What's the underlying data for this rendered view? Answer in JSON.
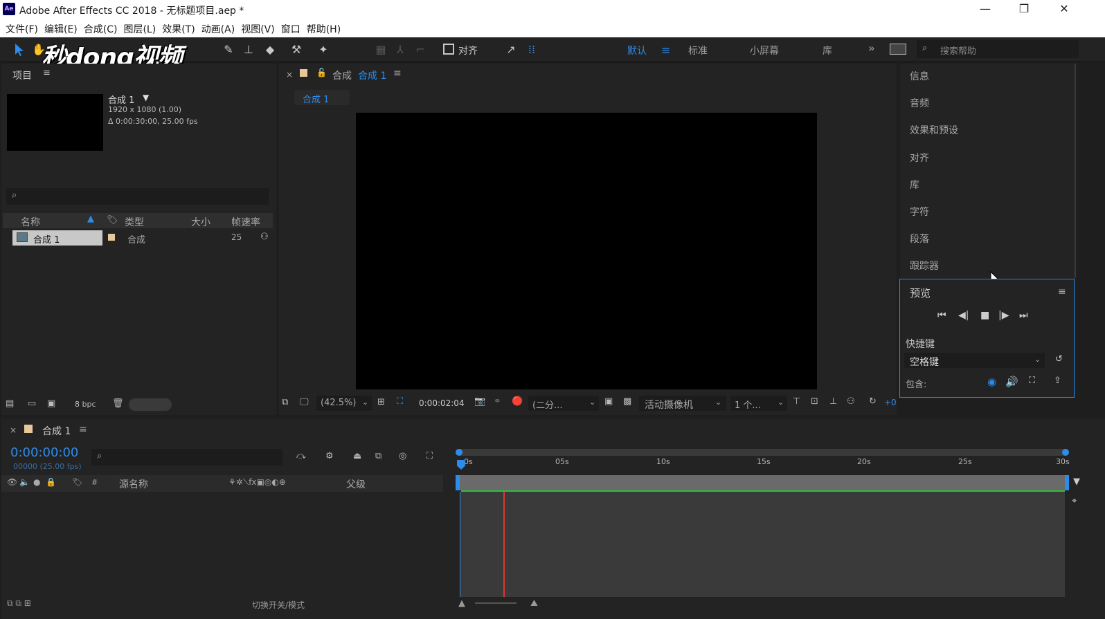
{
  "window": {
    "app_icon": "Ae",
    "title": "Adobe After Effects CC 2018 - 无标题项目.aep *",
    "minimize": "—",
    "maximize": "❐",
    "close": "✕"
  },
  "menu": [
    "文件(F)",
    "编辑(E)",
    "合成(C)",
    "图层(L)",
    "效果(T)",
    "动画(A)",
    "视图(V)",
    "窗口",
    "帮助(H)"
  ],
  "watermark": "秒dong视频",
  "toolbar": {
    "align_label": "对齐",
    "workspaces": [
      "默认",
      "标准",
      "小屏幕",
      "库"
    ],
    "more": "»",
    "search_placeholder": "搜索帮助"
  },
  "project": {
    "title": "项目",
    "comp_name": "合成 1",
    "comp_res": "1920 x 1080 (1.00)",
    "comp_dur": "Δ 0:00:30:00, 25.00 fps",
    "columns": [
      "名称",
      "类型",
      "大小",
      "帧速率"
    ],
    "rows": [
      {
        "name": "合成 1",
        "type": "合成",
        "size": "",
        "fps": "25"
      }
    ],
    "bpc": "8 bpc"
  },
  "composition": {
    "panel_prefix": "合成",
    "panel_name": "合成 1",
    "tab": "合成 1",
    "zoom": "(42.5%)",
    "timecode": "0:00:02:04",
    "resolution": "(二分...",
    "camera": "活动摄像机",
    "views": "1 个...",
    "exposure": "+0"
  },
  "right_panels": [
    "信息",
    "音频",
    "效果和预设",
    "对齐",
    "库",
    "字符",
    "段落",
    "跟踪器"
  ],
  "preview": {
    "title": "预览",
    "shortcut_label": "快捷键",
    "shortcut_value": "空格键",
    "include_label": "包含:"
  },
  "timeline": {
    "comp": "合成 1",
    "timecode": "0:00:00:00",
    "frames": "00000 (25.00 fps)",
    "source_name": "源名称",
    "parent": "父级",
    "ruler": [
      "0s",
      "05s",
      "10s",
      "15s",
      "20s",
      "25s",
      "30s"
    ],
    "toggle_label": "切换开关/模式"
  },
  "colors": {
    "accent": "#2d8ceb",
    "playhead": "#e0362c",
    "workarea": "#29c23a"
  }
}
